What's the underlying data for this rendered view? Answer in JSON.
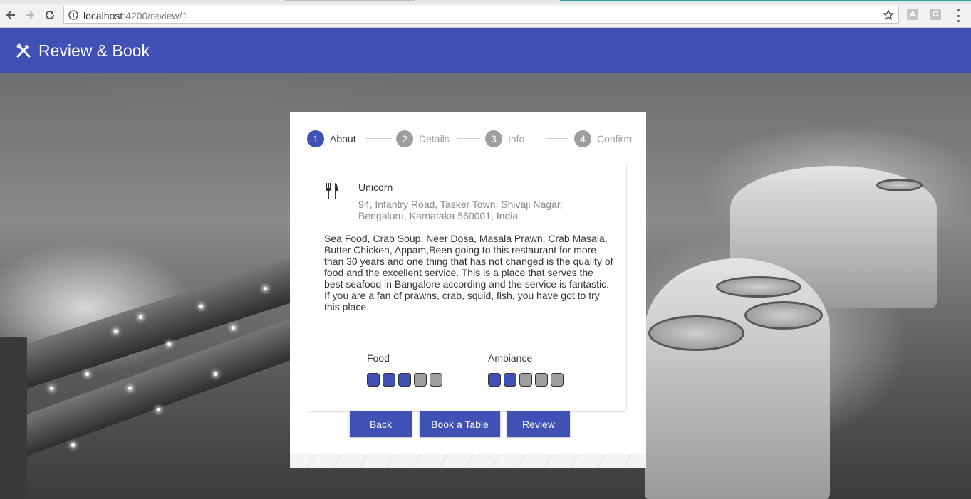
{
  "browser": {
    "url_host": "localhost",
    "url_path": ":4200/review/1",
    "ext1": "",
    "ext2": "G"
  },
  "app": {
    "title": "Review & Book"
  },
  "stepper": {
    "steps": [
      {
        "num": "1",
        "label": "About",
        "active": true
      },
      {
        "num": "2",
        "label": "Details",
        "active": false
      },
      {
        "num": "3",
        "label": "Info",
        "active": false
      },
      {
        "num": "4",
        "label": "Confirm",
        "active": false
      }
    ]
  },
  "restaurant": {
    "name": "Unicorn",
    "address": "94, Infantry Road, Tasker Town, Shivaji Nagar, Bengaluru, Karnataka 560001, India",
    "description": "Sea Food, Crab Soup, Neer Dosa, Masala Prawn, Crab Masala, Butter Chicken, Appam,Been going to this restaurant for more than 30 years and one thing that has not changed is the quality of food and the excellent service. This is a place that serves the best seafood in Bangalore according and the service is fantastic. If you are a fan of prawns, crab, squid, fish, you have got to try this place."
  },
  "ratings": {
    "food": {
      "label": "Food",
      "value": 3,
      "max": 5
    },
    "ambiance": {
      "label": "Ambiance",
      "value": 2,
      "max": 5
    }
  },
  "buttons": {
    "back": "Back",
    "book": "Book a Table",
    "review": "Review"
  },
  "colors": {
    "primary": "#3f51b5",
    "inactive": "#9e9e9e"
  }
}
